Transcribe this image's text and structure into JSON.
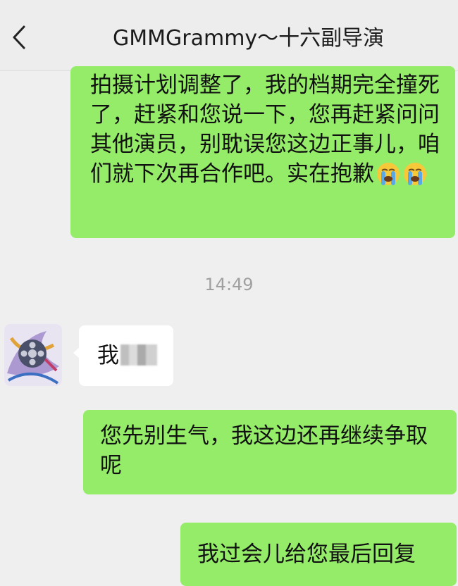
{
  "header": {
    "back_icon": "chevron-left-icon",
    "title": "GMMGrammy～十六副导演"
  },
  "messages": {
    "m1": {
      "text": "拍摄计划调整了，我的档期完全撞死了，赶紧和您说一下，您再赶紧问问其他演员，别耽误您这边正事儿，咱们就下次再合作吧。实在抱歉",
      "emoji": [
        "loudly-crying-face-icon",
        "loudly-crying-face-icon"
      ]
    },
    "timestamp": "14:49",
    "m2": {
      "text": "我"
    },
    "m3": {
      "text": "您先别生气，我这边还再继续争取呢"
    },
    "m4": {
      "text": "我过会儿给您最后回复"
    }
  },
  "colors": {
    "sent_bubble": "#95ec69",
    "received_bubble": "#ffffff",
    "background": "#efefef",
    "timestamp": "#a0a0a0"
  }
}
